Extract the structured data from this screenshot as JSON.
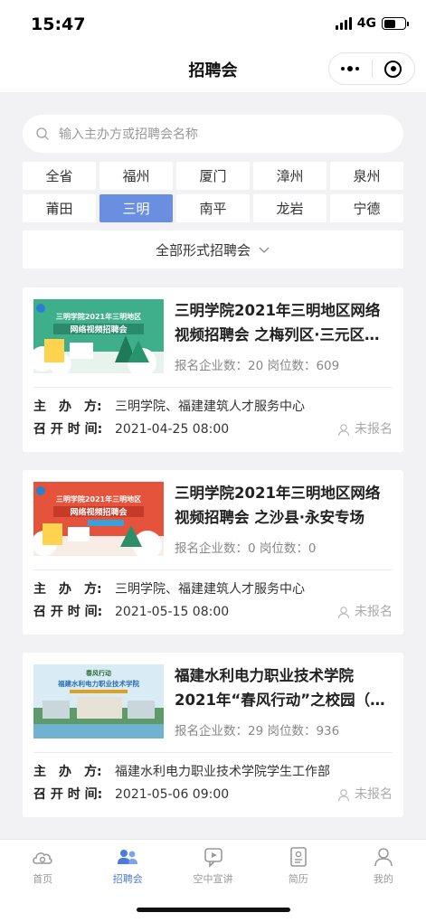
{
  "status_bar": {
    "time": "15:47",
    "network": "4G"
  },
  "nav": {
    "title": "招聘会"
  },
  "search": {
    "placeholder": "输入主办方或招聘会名称"
  },
  "cities": [
    "全省",
    "福州",
    "厦门",
    "漳州",
    "泉州",
    "莆田",
    "三明",
    "南平",
    "龙岩",
    "宁德"
  ],
  "active_city": "三明",
  "filter": {
    "label": "全部形式招聘会"
  },
  "labels": {
    "organizer": "主　办　方:",
    "time": "召 开 时 间:"
  },
  "fairs": [
    {
      "title": "三明学院2021年三明地区网络视频招聘会 之梅列区·三元区…",
      "stats": "报名企业数：20 岗位数：609",
      "organizer": "三明学院、福建建筑人才服务中心",
      "time": "2021-04-25 08:00",
      "status": "未报名",
      "thumb": {
        "line1": "三明学院2021年三明地区",
        "line2": "网络视频招聘会",
        "theme": "green"
      }
    },
    {
      "title": "三明学院2021年三明地区网络视频招聘会 之沙县·永安专场",
      "stats": "报名企业数：0 岗位数：0",
      "organizer": "三明学院、福建建筑人才服务中心",
      "time": "2021-05-15 08:00",
      "status": "未报名",
      "thumb": {
        "line1": "三明学院2021年三明地区",
        "line2": "网络视频招聘会",
        "theme": "red"
      }
    },
    {
      "title": "福建水利电力职业技术学院2021年“春风行动”之校园（…",
      "stats": "报名企业数：29 岗位数：936",
      "organizer": "福建水利电力职业技术学院学生工作部",
      "time": "2021-05-06 09:00",
      "status": "未报名",
      "thumb": {
        "line1": "福建水利电力职业技术学院",
        "line2": "春风行动",
        "theme": "campus"
      }
    }
  ],
  "tabbar": {
    "items": [
      {
        "label": "首页",
        "icon": "home-cloud-icon"
      },
      {
        "label": "招聘会",
        "icon": "people-icon"
      },
      {
        "label": "空中宣讲",
        "icon": "chat-broadcast-icon"
      },
      {
        "label": "简历",
        "icon": "resume-icon"
      },
      {
        "label": "我的",
        "icon": "user-icon"
      }
    ],
    "active": 1
  },
  "colors": {
    "accent": "#4c7be0",
    "active_city_bg": "#6a8fe0"
  }
}
